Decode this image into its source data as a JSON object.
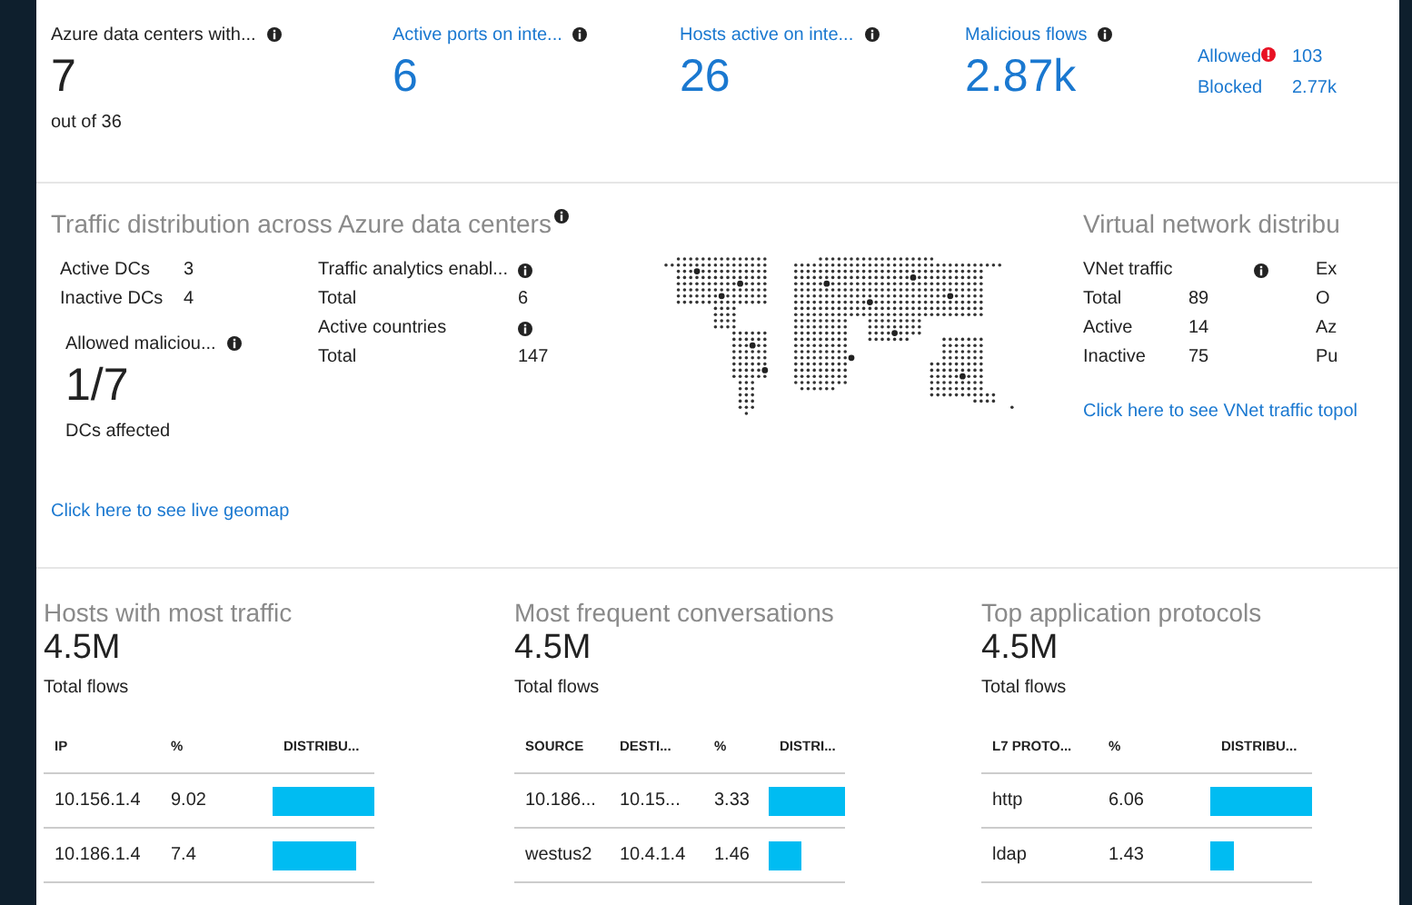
{
  "summary_tiles": [
    {
      "label": "Azure data centers with...",
      "value": "7",
      "note": "out of 36",
      "kind": "plain"
    },
    {
      "label": "Active ports on inte...",
      "value": "6",
      "kind": "link"
    },
    {
      "label": "Hosts active on inte...",
      "value": "26",
      "kind": "link"
    },
    {
      "label": "Malicious flows",
      "value": "2.87k",
      "kind": "link"
    }
  ],
  "flow_breakdown": [
    {
      "label": "Allowed",
      "value": "103",
      "alert": true
    },
    {
      "label": "Blocked",
      "value": "2.77k",
      "alert": false
    }
  ],
  "traffic_distribution": {
    "title": "Traffic distribution across Azure data centers",
    "dc_stats": [
      {
        "label": "Active DCs",
        "value": "3"
      },
      {
        "label": "Inactive DCs",
        "value": "4"
      }
    ],
    "allowed_malicious": {
      "label": "Allowed maliciou...",
      "value": "1/7",
      "note": "DCs affected"
    },
    "analytics": [
      {
        "label": "Traffic analytics enabl...",
        "kind": "heading"
      },
      {
        "label": "Total",
        "value": "6",
        "kind": "stat"
      },
      {
        "label": "Active countries",
        "kind": "heading"
      },
      {
        "label": "Total",
        "value": "147",
        "kind": "stat"
      }
    ],
    "link": "Click here to see live geomap"
  },
  "virtual_network": {
    "title": "Virtual network distribu",
    "heading": "VNet traffic",
    "stats": [
      {
        "label": "Total",
        "value": "89"
      },
      {
        "label": "Active",
        "value": "14"
      },
      {
        "label": "Inactive",
        "value": "75"
      }
    ],
    "column_2": [
      "Ex",
      "O",
      "Az",
      "Pu"
    ],
    "link": "Click here to see VNet traffic topol"
  },
  "top_lists": [
    {
      "title": "Hosts with most traffic",
      "total": "4.5M",
      "total_label": "Total flows",
      "columns": [
        "IP",
        "%",
        "DISTRIBU..."
      ],
      "rows": [
        {
          "cells": [
            "10.156.1.4",
            "9.02"
          ],
          "level": 1
        },
        {
          "cells": [
            "10.186.1.4",
            "7.4"
          ],
          "level": 0.82
        }
      ]
    },
    {
      "title": "Most frequent conversations",
      "total": "4.5M",
      "total_label": "Total flows",
      "columns": [
        "SOURCE",
        "DESTI...",
        "%",
        "DISTRI..."
      ],
      "rows": [
        {
          "cells": [
            "10.186...",
            "10.15...",
            "3.33"
          ],
          "level": 1
        },
        {
          "cells": [
            "westus2",
            "10.4.1.4",
            "1.46"
          ],
          "level": 0.44
        }
      ]
    },
    {
      "title": "Top application protocols",
      "total": "4.5M",
      "total_label": "Total flows",
      "columns": [
        "L7 PROTO...",
        "%",
        "DISTRIBU..."
      ],
      "rows": [
        {
          "cells": [
            "http",
            "6.06"
          ],
          "level": 1
        },
        {
          "cells": [
            "ldap",
            "1.43"
          ],
          "level": 0.24
        }
      ]
    }
  ]
}
